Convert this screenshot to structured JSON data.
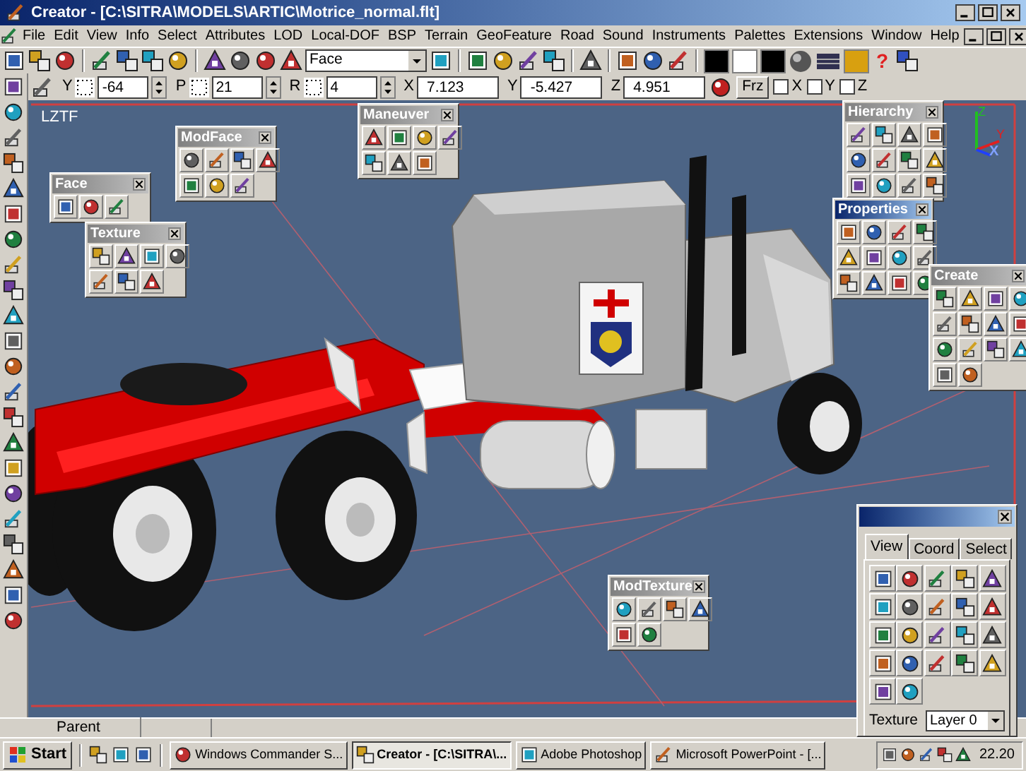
{
  "window": {
    "title": "Creator - [C:\\SITRA\\MODELS\\ARTIC\\Motrice_normal.flt]"
  },
  "menu": [
    "File",
    "Edit",
    "View",
    "Info",
    "Select",
    "Attributes",
    "LOD",
    "Local-DOF",
    "BSP",
    "Terrain",
    "GeoFeature",
    "Road",
    "Sound",
    "Instruments",
    "Palettes",
    "Extensions",
    "Window",
    "Help"
  ],
  "toolbar": {
    "mode_select": {
      "value": "Face"
    },
    "help": "?"
  },
  "transform_bar": {
    "fields": [
      {
        "label": "Y",
        "value": "-64",
        "kind": "spinner"
      },
      {
        "label": "P",
        "value": "21",
        "kind": "spinner"
      },
      {
        "label": "R",
        "value": "4",
        "kind": "spinner"
      },
      {
        "label": "X",
        "value": "7.123",
        "kind": "plain"
      },
      {
        "label": "Y",
        "value": "-5.427",
        "kind": "plain"
      },
      {
        "label": "Z",
        "value": "4.951",
        "kind": "plain"
      }
    ],
    "freeze_button": "Frz",
    "axis_checks": [
      {
        "label": "X",
        "checked": false
      },
      {
        "label": "Y",
        "checked": false
      },
      {
        "label": "Z",
        "checked": false
      }
    ]
  },
  "viewport": {
    "label": "LZTF",
    "axes": [
      "Z",
      "Y",
      "X"
    ]
  },
  "palettes": [
    {
      "title": "Face",
      "active": false
    },
    {
      "title": "Texture",
      "active": false
    },
    {
      "title": "ModFace",
      "active": false
    },
    {
      "title": "Maneuver",
      "active": false
    },
    {
      "title": "Hierarchy",
      "active": false
    },
    {
      "title": "Properties",
      "active": true
    },
    {
      "title": "Create",
      "active": false
    },
    {
      "title": "ModTexture",
      "active": false
    }
  ],
  "view_palette": {
    "tabs": [
      {
        "label": "View",
        "selected": true
      },
      {
        "label": "Coord",
        "selected": false
      },
      {
        "label": "Select",
        "selected": false
      }
    ],
    "texture_label": "Texture",
    "texture_value": "Layer 0"
  },
  "status_bar": {
    "text": "Parent"
  },
  "taskbar": {
    "start": "Start",
    "tasks": [
      {
        "label": "Windows Commander S...",
        "selected": false
      },
      {
        "label": "Creator - [C:\\SITRA\\...",
        "selected": true
      },
      {
        "label": "Adobe Photoshop",
        "selected": false
      },
      {
        "label": "Microsoft PowerPoint - [...",
        "selected": false
      }
    ],
    "clock": "22.20"
  }
}
